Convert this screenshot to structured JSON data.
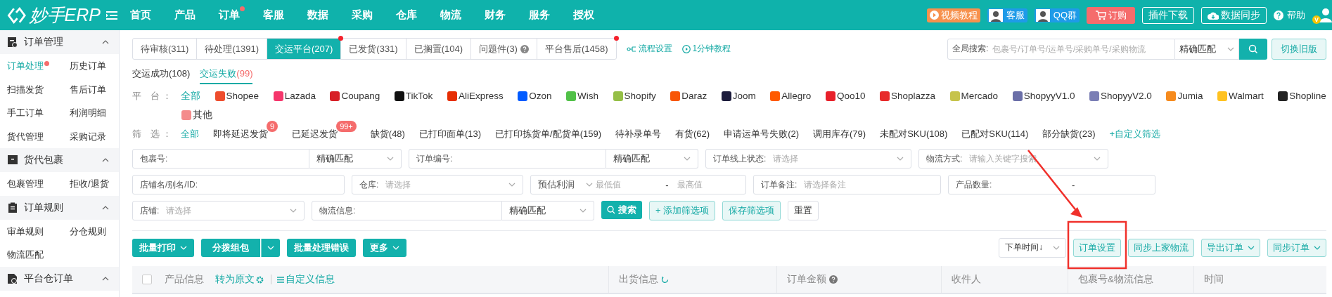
{
  "topbar": {
    "logo": "妙手ERP",
    "nav": [
      {
        "label": "首页",
        "dot": false
      },
      {
        "label": "产品",
        "dot": false
      },
      {
        "label": "订单",
        "dot": true
      },
      {
        "label": "客服",
        "dot": false
      },
      {
        "label": "数据",
        "dot": false
      },
      {
        "label": "采购",
        "dot": false
      },
      {
        "label": "仓库",
        "dot": false
      },
      {
        "label": "物流",
        "dot": false
      },
      {
        "label": "财务",
        "dot": false
      },
      {
        "label": "服务",
        "dot": false
      },
      {
        "label": "授权",
        "dot": false
      }
    ],
    "actions": [
      {
        "kind": "video",
        "label": "视频教程"
      },
      {
        "kind": "service",
        "label": "客服"
      },
      {
        "kind": "qq",
        "label": "QQ群"
      },
      {
        "kind": "order",
        "label": "订购"
      },
      {
        "kind": "download",
        "label": "插件下载"
      },
      {
        "kind": "sync",
        "label": "数据同步"
      },
      {
        "kind": "help",
        "label": "帮助"
      },
      {
        "kind": "user",
        "badge": "V"
      }
    ]
  },
  "sidebar": {
    "groups": [
      {
        "kind": "orders",
        "title": "订单管理",
        "expanded": true,
        "items": [
          {
            "label": "订单处理",
            "selected": true,
            "dot": true
          },
          {
            "label": "历史订单",
            "selected": false,
            "dot": false
          },
          {
            "label": "扫描发货",
            "selected": false,
            "dot": false
          },
          {
            "label": "售后订单",
            "selected": false,
            "dot": false
          },
          {
            "label": "手工订单",
            "selected": false,
            "dot": false
          },
          {
            "label": "利润明细",
            "selected": false,
            "dot": false
          },
          {
            "label": "货代管理",
            "selected": false,
            "dot": false
          },
          {
            "label": "采购记录",
            "selected": false,
            "dot": false
          }
        ]
      },
      {
        "kind": "packages",
        "title": "货代包裹",
        "expanded": true,
        "items": [
          {
            "label": "包裹管理",
            "selected": false,
            "dot": false
          },
          {
            "label": "拒收/退货",
            "selected": false,
            "dot": false
          }
        ]
      },
      {
        "kind": "rules",
        "title": "订单规则",
        "expanded": true,
        "items": [
          {
            "label": "审单规则",
            "selected": false,
            "dot": false
          },
          {
            "label": "分仓规则",
            "selected": false,
            "dot": false
          },
          {
            "label": "物流匹配",
            "selected": false,
            "dot": false
          }
        ]
      },
      {
        "kind": "warehouse",
        "title": "平台仓订单",
        "expanded": true
      }
    ]
  },
  "tabs": [
    {
      "label": "待审核(311)",
      "selected": false,
      "dot": false,
      "help": false
    },
    {
      "label": "待处理(1391)",
      "selected": false,
      "dot": false,
      "help": false
    },
    {
      "label": "交运平台(207)",
      "selected": true,
      "dot": true,
      "help": false
    },
    {
      "label": "已发货(331)",
      "selected": false,
      "dot": false,
      "help": false
    },
    {
      "label": "已搁置(104)",
      "selected": false,
      "dot": false,
      "help": false
    },
    {
      "label": "问题件(3)",
      "selected": false,
      "dot": false,
      "help": true
    },
    {
      "label": "平台售后(1458)",
      "selected": false,
      "dot": true,
      "help": false
    }
  ],
  "tab_links": [
    {
      "kind": "flow",
      "label": "流程设置"
    },
    {
      "kind": "video",
      "label": "1分钟教程"
    }
  ],
  "global_search": {
    "label": "全局搜索:",
    "placeholder": "包裹号/订单号/运单号/采购单号/采购物流",
    "match": "精确匹配"
  },
  "switch_button": "切换旧版",
  "subtabs": [
    {
      "label": "交运成功",
      "count": "(108)",
      "selected": false
    },
    {
      "label": "交运失败",
      "count": "(99)",
      "selected": true
    }
  ],
  "platforms": {
    "label": "平 台：",
    "items": [
      {
        "label": "全部",
        "selected": true
      },
      {
        "label": "Shopee",
        "color": "#ee4d2d",
        "selected": false
      },
      {
        "label": "Lazada",
        "color": "#f5366b",
        "selected": false
      },
      {
        "label": "Coupang",
        "color": "#d71f26",
        "selected": false
      },
      {
        "label": "TikTok",
        "color": "#111111",
        "selected": false
      },
      {
        "label": "AliExpress",
        "color": "#e62e04",
        "selected": false
      },
      {
        "label": "Ozon",
        "color": "#005bff",
        "selected": false
      },
      {
        "label": "Wish",
        "color": "#51c148",
        "selected": false
      },
      {
        "label": "Shopify",
        "color": "#95bf47",
        "selected": false
      },
      {
        "label": "Daraz",
        "color": "#f85606",
        "selected": false
      },
      {
        "label": "Joom",
        "color": "#1c1c3c",
        "selected": false
      },
      {
        "label": "Allegro",
        "color": "#ff5a00",
        "selected": false
      },
      {
        "label": "Qoo10",
        "color": "#e8202a",
        "selected": false
      },
      {
        "label": "Shoplazza",
        "color": "#e72a2a",
        "selected": false
      },
      {
        "label": "Mercado",
        "color": "#c6c34b",
        "selected": false
      },
      {
        "label": "ShopyyV1.0",
        "color": "#6b6fa8",
        "selected": false
      },
      {
        "label": "ShopyyV2.0",
        "color": "#7a7eb5",
        "selected": false
      },
      {
        "label": "Jumia",
        "color": "#f68b1e",
        "selected": false
      },
      {
        "label": "Walmart",
        "color": "#ffc220",
        "selected": false
      },
      {
        "label": "Shopline",
        "color": "#222222",
        "selected": false
      },
      {
        "label": "其他",
        "color": "#f48b8b",
        "selected": false
      }
    ]
  },
  "filters": {
    "label": "筛 选：",
    "items": [
      {
        "kind": "chip",
        "label": "全部",
        "selected": true
      },
      {
        "kind": "chip",
        "label": "即将延迟发货",
        "badge": "9",
        "selected": false
      },
      {
        "kind": "chip",
        "label": "已延迟发货",
        "badge": "99+",
        "selected": false
      },
      {
        "kind": "chip",
        "label": "缺货(48)",
        "selected": false
      },
      {
        "kind": "chip",
        "label": "已打印面单(13)",
        "selected": false
      },
      {
        "kind": "chip",
        "label": "已打印拣货单/配货单(159)",
        "selected": false
      },
      {
        "kind": "chip",
        "label": "待补录单号",
        "selected": false
      },
      {
        "kind": "chip",
        "label": "有货(62)",
        "selected": false
      },
      {
        "kind": "chip",
        "label": "申请运单号失败(2)",
        "selected": false
      },
      {
        "kind": "chip",
        "label": "调用库存(79)",
        "selected": false
      },
      {
        "kind": "chip",
        "label": "未配对SKU(108)",
        "selected": false
      },
      {
        "kind": "chip",
        "label": "已配对SKU(114)",
        "selected": false
      },
      {
        "kind": "chip",
        "label": "部分缺货(23)",
        "selected": false
      },
      {
        "kind": "link",
        "label": "+自定义筛选"
      }
    ]
  },
  "search_form": {
    "lines": [
      {
        "fields": [
          {
            "kind": "input_select",
            "label": "包裹号:",
            "match": "精确匹配"
          },
          {
            "kind": "input_select",
            "label": "订单编号:",
            "match": "精确匹配"
          },
          {
            "kind": "select",
            "label": "订单线上状态:",
            "placeholder": "请选择"
          },
          {
            "kind": "select",
            "label": "物流方式:",
            "placeholder": "请输入关键字搜索"
          }
        ]
      },
      {
        "fields": [
          {
            "kind": "input",
            "label": "店铺名/别名/ID:"
          },
          {
            "kind": "select",
            "label": "仓库:",
            "placeholder": "请选择"
          },
          {
            "kind": "range_select",
            "label": "预估利润",
            "min_placeholder": "最低值",
            "separator": "-",
            "max_placeholder": "最高值"
          },
          {
            "kind": "input",
            "label": "订单备注:",
            "placeholder": "请选择备注"
          },
          {
            "kind": "range",
            "label": "产品数量:",
            "separator": "-"
          }
        ]
      },
      {
        "fields": [
          {
            "kind": "select",
            "label": "店铺:",
            "placeholder": "请选择"
          },
          {
            "kind": "input_select",
            "label": "物流信息:",
            "match": "精确匹配"
          },
          {
            "kind": "primary",
            "label": "搜索"
          },
          {
            "kind": "light",
            "label": "+ 添加筛选项"
          },
          {
            "kind": "light",
            "label": "保存筛选项"
          },
          {
            "kind": "plain",
            "label": "重置"
          }
        ]
      }
    ]
  },
  "actions_left": [
    {
      "kind": "dropdown",
      "label": "批量打印"
    },
    {
      "kind": "split",
      "label": "分拨组包"
    },
    {
      "kind": "plain",
      "label": "批量处理错误"
    },
    {
      "kind": "dropdown",
      "label": "更多"
    }
  ],
  "actions_right": [
    {
      "kind": "sort",
      "label": "下单时间↓"
    },
    {
      "kind": "light",
      "label": "订单设置"
    },
    {
      "kind": "light",
      "label": "同步上家物流"
    },
    {
      "kind": "light_dropdown",
      "label": "导出订单"
    },
    {
      "kind": "light_dropdown",
      "label": "同步订单"
    }
  ],
  "table": {
    "select_all": {
      "checked": false
    },
    "columns": [
      {
        "kind": "product",
        "label": "产品信息",
        "links": [
          "转为原文",
          "自定义信息"
        ]
      },
      {
        "kind": "refresh",
        "label": "出货信息"
      },
      {
        "kind": "help",
        "label": "订单金额"
      },
      {
        "kind": "plain",
        "label": "收件人"
      },
      {
        "kind": "plain",
        "label": "包裹号&物流信息"
      },
      {
        "kind": "plain",
        "label": "时间"
      }
    ]
  },
  "annotation": {
    "arrow": true,
    "highlight_box": true
  }
}
